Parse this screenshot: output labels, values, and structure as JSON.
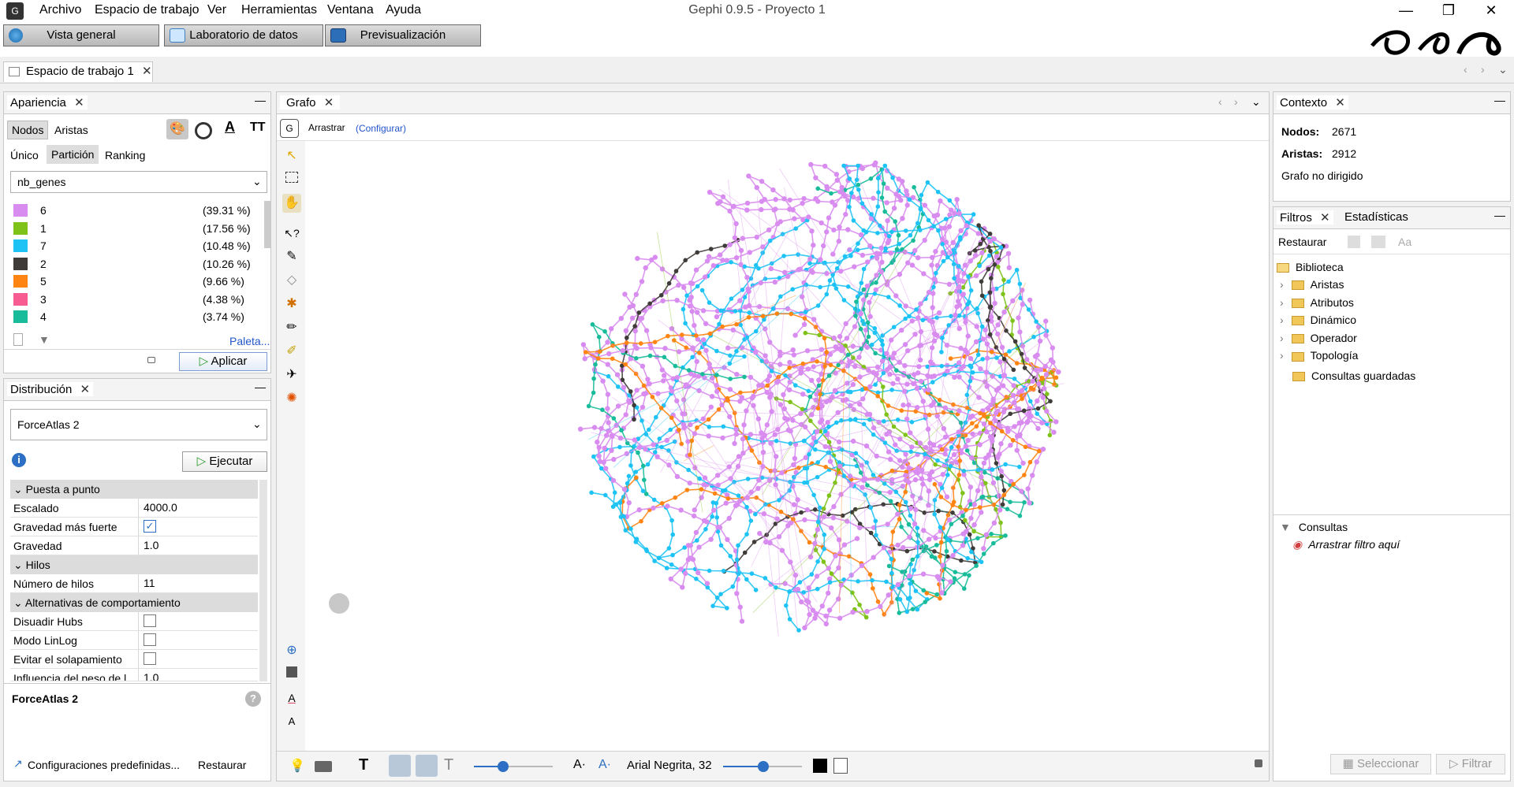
{
  "titlebar": {
    "menus": [
      "Archivo",
      "Espacio de trabajo",
      "Ver",
      "Herramientas",
      "Ventana",
      "Ayuda"
    ],
    "title": "Gephi 0.9.5 - Proyecto 1",
    "controls": [
      "—",
      "❐",
      "✕"
    ]
  },
  "modes": [
    "Vista general",
    "Laboratorio de datos",
    "Previsualización"
  ],
  "workspace": {
    "tab": "Espacio de trabajo 1"
  },
  "appearance": {
    "title": "Apariencia",
    "target_tabs": [
      "Nodos",
      "Aristas"
    ],
    "mode_tabs": [
      "Único",
      "Partición",
      "Ranking"
    ],
    "attribute": "nb_genes",
    "partitions": [
      {
        "label": "6",
        "pct": "(39.31 %)",
        "color": "#d98cf0"
      },
      {
        "label": "1",
        "pct": "(17.56 %)",
        "color": "#7ec21a"
      },
      {
        "label": "7",
        "pct": "(10.48 %)",
        "color": "#1ec3f5"
      },
      {
        "label": "2",
        "pct": "(10.26 %)",
        "color": "#3f3b38"
      },
      {
        "label": "5",
        "pct": "(9.66 %)",
        "color": "#ff8412"
      },
      {
        "label": "3",
        "pct": "(4.38 %)",
        "color": "#f75b92"
      },
      {
        "label": "4",
        "pct": "(3.74 %)",
        "color": "#18bc9a"
      }
    ],
    "palette_link": "Paleta...",
    "apply": "Aplicar"
  },
  "layout": {
    "title": "Distribución",
    "algorithm": "ForceAtlas 2",
    "run": "Ejecutar",
    "sections": {
      "tuning": "Puesta a punto",
      "threads": "Hilos",
      "behavior": "Alternativas de comportamiento"
    },
    "props": {
      "scaling_label": "Escalado",
      "scaling": "4000.0",
      "stronger_label": "Gravedad más fuerte",
      "gravity_label": "Gravedad",
      "gravity": "1.0",
      "threads_label": "Número de hilos",
      "threads": "11",
      "hubs_label": "Disuadir Hubs",
      "linlog_label": "Modo LinLog",
      "overlap_label": "Evitar el solapamiento",
      "weight_label": "Influencia del peso de l",
      "weight": "1.0"
    },
    "desc_title": "ForceAtlas 2",
    "presets": "Configuraciones predefinidas...",
    "reset": "Restaurar"
  },
  "graph": {
    "tab": "Grafo",
    "tool": "Arrastrar",
    "configure": "(Configurar)",
    "font": "Arial Negrita, 32"
  },
  "context": {
    "title": "Contexto",
    "nodes_label": "Nodos:",
    "nodes": "2671",
    "edges_label": "Aristas:",
    "edges": "2912",
    "type": "Grafo no dirigido"
  },
  "filters": {
    "tabs": [
      "Filtros",
      "Estadísticas"
    ],
    "reset": "Restaurar",
    "library": "Biblioteca",
    "items": [
      "Aristas",
      "Atributos",
      "Dinámico",
      "Operador",
      "Topología"
    ],
    "saved": "Consultas guardadas",
    "queries": "Consultas",
    "drop": "Arrastrar filtro aquí",
    "select": "Seleccionar",
    "filter": "Filtrar"
  }
}
